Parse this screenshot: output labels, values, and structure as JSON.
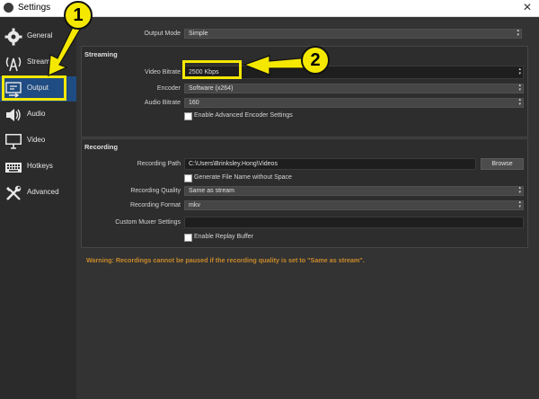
{
  "window": {
    "title": "Settings",
    "close_label": "✕"
  },
  "sidebar": {
    "items": [
      {
        "label": "General",
        "icon": "gear-icon"
      },
      {
        "label": "Stream",
        "icon": "antenna-icon"
      },
      {
        "label": "Output",
        "icon": "output-icon"
      },
      {
        "label": "Audio",
        "icon": "speaker-icon"
      },
      {
        "label": "Video",
        "icon": "monitor-icon"
      },
      {
        "label": "Hotkeys",
        "icon": "keyboard-icon"
      },
      {
        "label": "Advanced",
        "icon": "wrench-screwdriver-icon"
      }
    ],
    "active_item": "Output"
  },
  "output_mode": {
    "label": "Output Mode",
    "value": "Simple"
  },
  "streaming": {
    "title": "Streaming",
    "video_bitrate": {
      "label": "Video Bitrate",
      "value": "2500 Kbps"
    },
    "encoder": {
      "label": "Encoder",
      "value": "Software (x264)"
    },
    "audio_bitrate": {
      "label": "Audio Bitrate",
      "value": "160"
    },
    "advanced_encoder": {
      "label": "Enable Advanced Encoder Settings",
      "checked": false
    }
  },
  "recording": {
    "title": "Recording",
    "path": {
      "label": "Recording Path",
      "value": "C:\\Users\\Brinksley.Hong\\Videos",
      "browse_label": "Browse"
    },
    "no_space": {
      "label": "Generate File Name without Space",
      "checked": false
    },
    "quality": {
      "label": "Recording Quality",
      "value": "Same as stream"
    },
    "format": {
      "label": "Recording Format",
      "value": "mkv"
    },
    "muxer": {
      "label": "Custom Muxer Settings",
      "value": ""
    },
    "replay_buffer": {
      "label": "Enable Replay Buffer",
      "checked": false
    }
  },
  "warning": "Warning: Recordings cannot be paused if the recording quality is set to \"Same as stream\".",
  "annotations": [
    {
      "number": "1",
      "color": "#f4e800"
    },
    {
      "number": "2",
      "color": "#f4e800"
    }
  ]
}
